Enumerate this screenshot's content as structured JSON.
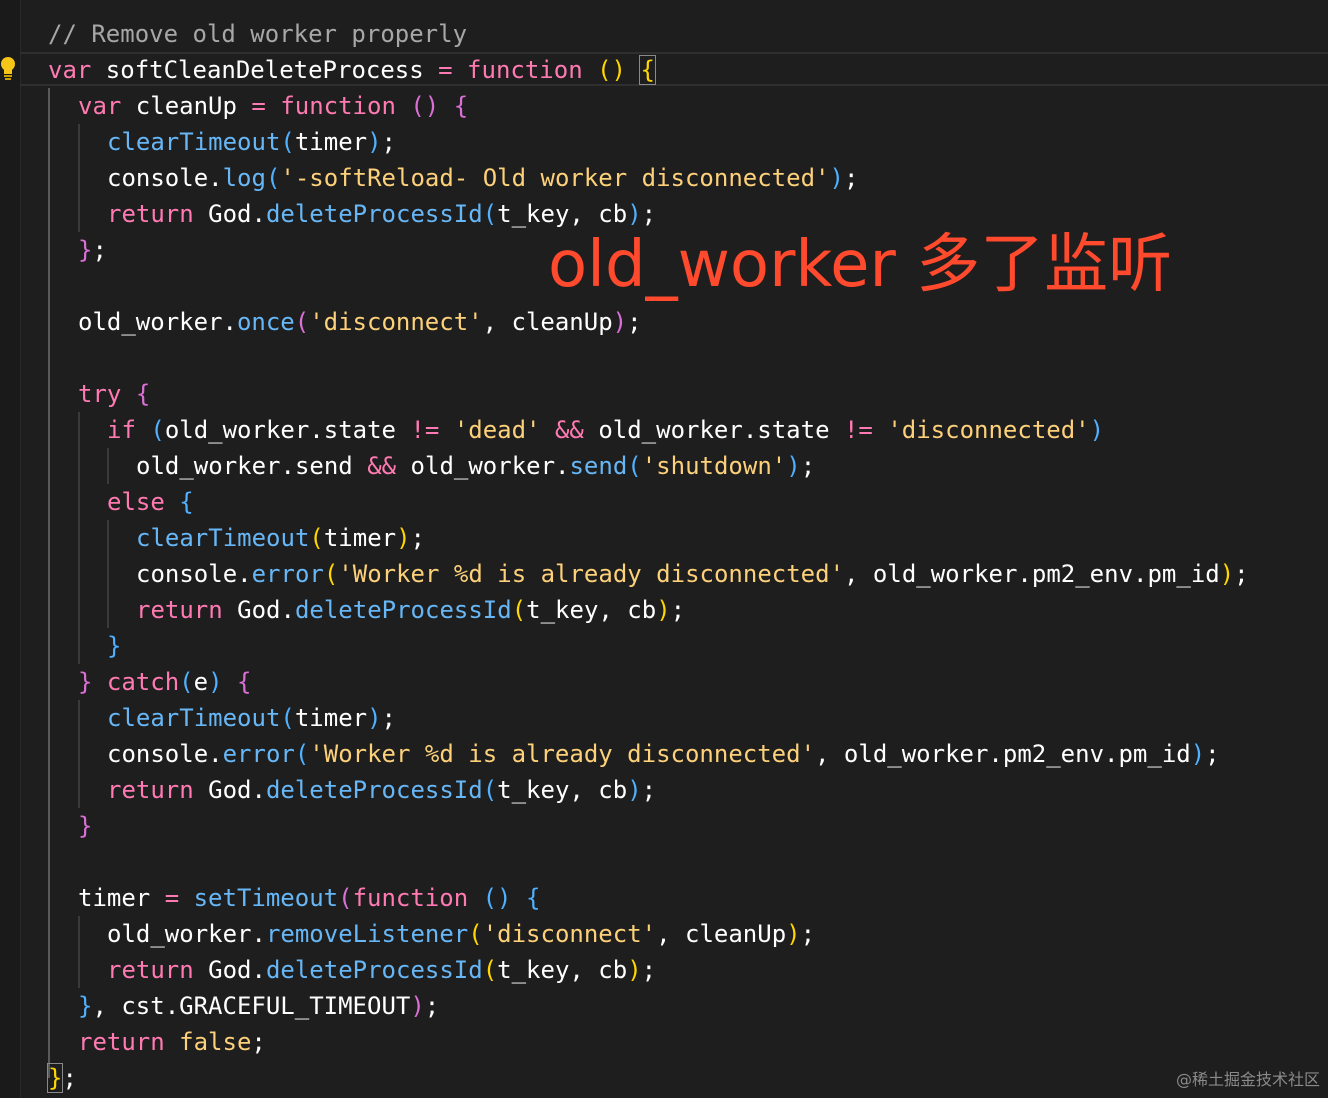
{
  "lines": [
    {
      "tokens": [
        {
          "t": "// Remove old worker properly",
          "c": "cm"
        }
      ]
    },
    {
      "tokens": [
        {
          "t": "var",
          "c": "kw"
        },
        {
          "t": " softCleanDeleteProcess "
        },
        {
          "t": "=",
          "c": "op"
        },
        {
          "t": " "
        },
        {
          "t": "function",
          "c": "kw"
        },
        {
          "t": " "
        },
        {
          "t": "()",
          "c": "br1"
        },
        {
          "t": " "
        },
        {
          "t": "{",
          "c": "br1 bm"
        }
      ]
    },
    {
      "tokens": [
        {
          "t": "var",
          "c": "kw"
        },
        {
          "t": " cleanUp "
        },
        {
          "t": "=",
          "c": "op"
        },
        {
          "t": " "
        },
        {
          "t": "function",
          "c": "kw"
        },
        {
          "t": " "
        },
        {
          "t": "()",
          "c": "br2"
        },
        {
          "t": " "
        },
        {
          "t": "{",
          "c": "br2"
        }
      ]
    },
    {
      "tokens": [
        {
          "t": "clearTimeout",
          "c": "fn"
        },
        {
          "t": "(",
          "c": "br3"
        },
        {
          "t": "timer"
        },
        {
          "t": ")",
          "c": "br3"
        },
        {
          "t": ";"
        }
      ]
    },
    {
      "tokens": [
        {
          "t": "console."
        },
        {
          "t": "log",
          "c": "fn"
        },
        {
          "t": "(",
          "c": "br3"
        },
        {
          "t": "'-softReload- Old worker disconnected'",
          "c": "str"
        },
        {
          "t": ")",
          "c": "br3"
        },
        {
          "t": ";"
        }
      ]
    },
    {
      "tokens": [
        {
          "t": "return",
          "c": "kw"
        },
        {
          "t": " God."
        },
        {
          "t": "deleteProcessId",
          "c": "fn"
        },
        {
          "t": "(",
          "c": "br3"
        },
        {
          "t": "t_key, cb"
        },
        {
          "t": ")",
          "c": "br3"
        },
        {
          "t": ";"
        }
      ]
    },
    {
      "tokens": [
        {
          "t": "}",
          "c": "br2"
        },
        {
          "t": ";"
        }
      ]
    },
    {
      "tokens": []
    },
    {
      "tokens": [
        {
          "t": "old_worker."
        },
        {
          "t": "once",
          "c": "fn"
        },
        {
          "t": "(",
          "c": "br2"
        },
        {
          "t": "'disconnect'",
          "c": "str"
        },
        {
          "t": ", cleanUp"
        },
        {
          "t": ")",
          "c": "br2"
        },
        {
          "t": ";"
        }
      ]
    },
    {
      "tokens": []
    },
    {
      "tokens": [
        {
          "t": "try",
          "c": "kw"
        },
        {
          "t": " "
        },
        {
          "t": "{",
          "c": "br2"
        }
      ]
    },
    {
      "tokens": [
        {
          "t": "if",
          "c": "kw"
        },
        {
          "t": " "
        },
        {
          "t": "(",
          "c": "br3"
        },
        {
          "t": "old_worker.state "
        },
        {
          "t": "!=",
          "c": "op"
        },
        {
          "t": " "
        },
        {
          "t": "'dead'",
          "c": "str"
        },
        {
          "t": " "
        },
        {
          "t": "&&",
          "c": "op"
        },
        {
          "t": " old_worker.state "
        },
        {
          "t": "!=",
          "c": "op"
        },
        {
          "t": " "
        },
        {
          "t": "'disconnected'",
          "c": "str"
        },
        {
          "t": ")",
          "c": "br3"
        }
      ]
    },
    {
      "tokens": [
        {
          "t": "old_worker.send "
        },
        {
          "t": "&&",
          "c": "op"
        },
        {
          "t": " old_worker."
        },
        {
          "t": "send",
          "c": "fn"
        },
        {
          "t": "(",
          "c": "br3"
        },
        {
          "t": "'shutdown'",
          "c": "str"
        },
        {
          "t": ")",
          "c": "br3"
        },
        {
          "t": ";"
        }
      ]
    },
    {
      "tokens": [
        {
          "t": "else",
          "c": "kw"
        },
        {
          "t": " "
        },
        {
          "t": "{",
          "c": "br3"
        }
      ]
    },
    {
      "tokens": [
        {
          "t": "clearTimeout",
          "c": "fn"
        },
        {
          "t": "(",
          "c": "br1"
        },
        {
          "t": "timer"
        },
        {
          "t": ")",
          "c": "br1"
        },
        {
          "t": ";"
        }
      ]
    },
    {
      "tokens": [
        {
          "t": "console."
        },
        {
          "t": "error",
          "c": "fn"
        },
        {
          "t": "(",
          "c": "br1"
        },
        {
          "t": "'Worker %d is already disconnected'",
          "c": "str"
        },
        {
          "t": ", old_worker.pm2_env.pm_id"
        },
        {
          "t": ")",
          "c": "br1"
        },
        {
          "t": ";"
        }
      ]
    },
    {
      "tokens": [
        {
          "t": "return",
          "c": "kw"
        },
        {
          "t": " God."
        },
        {
          "t": "deleteProcessId",
          "c": "fn"
        },
        {
          "t": "(",
          "c": "br1"
        },
        {
          "t": "t_key, cb"
        },
        {
          "t": ")",
          "c": "br1"
        },
        {
          "t": ";"
        }
      ]
    },
    {
      "tokens": [
        {
          "t": "}",
          "c": "br3"
        }
      ]
    },
    {
      "tokens": [
        {
          "t": "}",
          "c": "br2"
        },
        {
          "t": " "
        },
        {
          "t": "catch",
          "c": "kw"
        },
        {
          "t": "(",
          "c": "br3"
        },
        {
          "t": "e"
        },
        {
          "t": ")",
          "c": "br3"
        },
        {
          "t": " "
        },
        {
          "t": "{",
          "c": "br2"
        }
      ]
    },
    {
      "tokens": [
        {
          "t": "clearTimeout",
          "c": "fn"
        },
        {
          "t": "(",
          "c": "br3"
        },
        {
          "t": "timer"
        },
        {
          "t": ")",
          "c": "br3"
        },
        {
          "t": ";"
        }
      ]
    },
    {
      "tokens": [
        {
          "t": "console."
        },
        {
          "t": "error",
          "c": "fn"
        },
        {
          "t": "(",
          "c": "br3"
        },
        {
          "t": "'Worker %d is already disconnected'",
          "c": "str"
        },
        {
          "t": ", old_worker.pm2_env.pm_id"
        },
        {
          "t": ")",
          "c": "br3"
        },
        {
          "t": ";"
        }
      ]
    },
    {
      "tokens": [
        {
          "t": "return",
          "c": "kw"
        },
        {
          "t": " God."
        },
        {
          "t": "deleteProcessId",
          "c": "fn"
        },
        {
          "t": "(",
          "c": "br3"
        },
        {
          "t": "t_key, cb"
        },
        {
          "t": ")",
          "c": "br3"
        },
        {
          "t": ";"
        }
      ]
    },
    {
      "tokens": [
        {
          "t": "}",
          "c": "br2"
        }
      ]
    },
    {
      "tokens": []
    },
    {
      "tokens": [
        {
          "t": "timer "
        },
        {
          "t": "=",
          "c": "op"
        },
        {
          "t": " "
        },
        {
          "t": "setTimeout",
          "c": "fn"
        },
        {
          "t": "(",
          "c": "br2"
        },
        {
          "t": "function",
          "c": "kw"
        },
        {
          "t": " "
        },
        {
          "t": "()",
          "c": "br3"
        },
        {
          "t": " "
        },
        {
          "t": "{",
          "c": "br3"
        }
      ]
    },
    {
      "tokens": [
        {
          "t": "old_worker."
        },
        {
          "t": "removeListener",
          "c": "fn"
        },
        {
          "t": "(",
          "c": "br1"
        },
        {
          "t": "'disconnect'",
          "c": "str"
        },
        {
          "t": ", cleanUp"
        },
        {
          "t": ")",
          "c": "br1"
        },
        {
          "t": ";"
        }
      ]
    },
    {
      "tokens": [
        {
          "t": "return",
          "c": "kw"
        },
        {
          "t": " God."
        },
        {
          "t": "deleteProcessId",
          "c": "fn"
        },
        {
          "t": "(",
          "c": "br1"
        },
        {
          "t": "t_key, cb"
        },
        {
          "t": ")",
          "c": "br1"
        },
        {
          "t": ";"
        }
      ]
    },
    {
      "tokens": [
        {
          "t": "}",
          "c": "br3"
        },
        {
          "t": ", cst.GRACEFUL_TIMEOUT"
        },
        {
          "t": ")",
          "c": "br2"
        },
        {
          "t": ";"
        }
      ]
    },
    {
      "tokens": [
        {
          "t": "return",
          "c": "kw"
        },
        {
          "t": " "
        },
        {
          "t": "false",
          "c": "str"
        },
        {
          "t": ";"
        }
      ]
    },
    {
      "tokens": [
        {
          "t": "}",
          "c": "br1 bm"
        },
        {
          "t": ";"
        }
      ]
    }
  ],
  "annotation": "old_worker 多了监听",
  "watermark": "@稀土掘金技术社区",
  "icons": {
    "gutter": "lightbulb-icon"
  }
}
